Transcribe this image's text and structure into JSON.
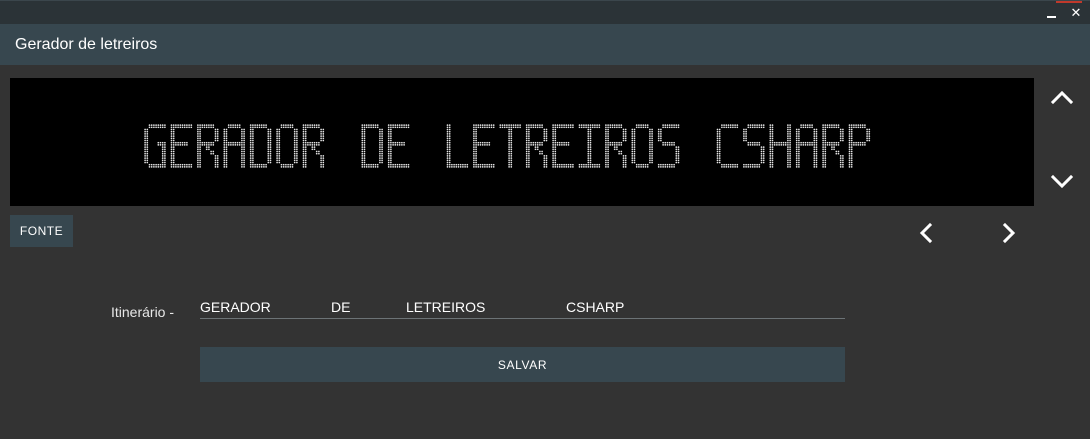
{
  "window": {
    "minimize_label": "_",
    "close_label": "✕",
    "accent_color": "#c0392b"
  },
  "appbar": {
    "title": "Gerador de letreiros",
    "color": "#37474f"
  },
  "display": {
    "text": "GERADOR DE LETREIROS CSHARP",
    "dot_color": "#e6e6e6",
    "background": "#000000"
  },
  "controls": {
    "fonte_label": "FONTE",
    "scroll_up_icon": "chevron-up-icon",
    "scroll_down_icon": "chevron-down-icon",
    "prev_icon": "chevron-left-icon",
    "next_icon": "chevron-right-icon"
  },
  "form": {
    "itinerario_label": "Itinerário -",
    "itinerario_words": [
      "GERADOR",
      "DE",
      "LETREIROS",
      "CSHARP"
    ],
    "save_label": "SALVAR"
  }
}
